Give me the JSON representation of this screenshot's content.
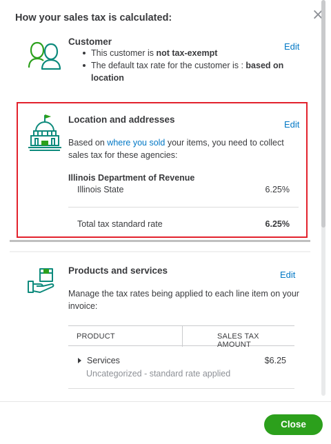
{
  "header": {
    "title": "How your sales tax is calculated:"
  },
  "customer": {
    "title": "Customer",
    "edit_label": "Edit",
    "bullet1_prefix": "This customer is ",
    "bullet1_bold": "not tax-exempt",
    "bullet2_prefix": "The default tax rate for the customer is : ",
    "bullet2_bold": "based on location"
  },
  "location": {
    "title": "Location and addresses",
    "edit_label": "Edit",
    "desc_prefix": "Based on ",
    "desc_link": "where you sold",
    "desc_suffix": " your items, you need to collect sales tax for these agencies:",
    "agency": "Illinois Department of Revenue",
    "agency_row_label": "Illinois State",
    "agency_row_value": "6.25%",
    "total_label": "Total tax standard rate",
    "total_value": "6.25%"
  },
  "products": {
    "title": "Products and services",
    "edit_label": "Edit",
    "desc": "Manage the tax rates being applied to each line item on your invoice:",
    "col_product": "PRODUCT",
    "col_amount": "SALES TAX AMOUNT",
    "row_name": "Services",
    "row_amount": "$6.25",
    "row_note": "Uncategorized - standard rate applied"
  },
  "footer": {
    "close_label": "Close"
  },
  "colors": {
    "accent_link": "#0077c5",
    "icon_green": "#108000",
    "icon_teal": "#0d8a7c",
    "highlight_red": "#e2202b",
    "button_green": "#2ca01c"
  },
  "icons": [
    "close-icon",
    "customers-icon",
    "capitol-building-icon",
    "hand-box-icon",
    "caret-right-icon"
  ]
}
